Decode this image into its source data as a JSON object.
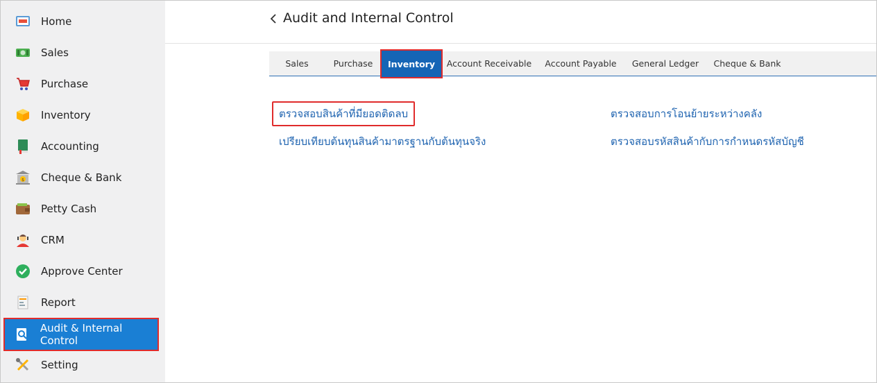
{
  "sidebar": {
    "items": [
      {
        "label": "Home",
        "icon": "home-icon"
      },
      {
        "label": "Sales",
        "icon": "cash-icon"
      },
      {
        "label": "Purchase",
        "icon": "cart-icon"
      },
      {
        "label": "Inventory",
        "icon": "box-icon"
      },
      {
        "label": "Accounting",
        "icon": "ledger-book-icon"
      },
      {
        "label": "Cheque & Bank",
        "icon": "bank-icon"
      },
      {
        "label": "Petty Cash",
        "icon": "wallet-icon"
      },
      {
        "label": "CRM",
        "icon": "customer-icon"
      },
      {
        "label": "Approve Center",
        "icon": "check-circle-icon"
      },
      {
        "label": "Report",
        "icon": "report-icon"
      },
      {
        "label": "Audit & Internal Control",
        "icon": "audit-search-icon",
        "active": true
      },
      {
        "label": "Setting",
        "icon": "tools-icon"
      }
    ]
  },
  "header": {
    "title": "Audit and Internal Control"
  },
  "tabs": [
    {
      "label": "Sales"
    },
    {
      "label": "Purchase"
    },
    {
      "label": "Inventory",
      "active": true
    },
    {
      "label": "Account Receivable"
    },
    {
      "label": "Account Payable"
    },
    {
      "label": "General Ledger"
    },
    {
      "label": "Cheque & Bank"
    }
  ],
  "links": {
    "left": [
      "ตรวจสอบสินค้าที่มียอดติดลบ",
      "เปรียบเทียบต้นทุนสินค้ามาตรฐานกับต้นทุนจริง"
    ],
    "right": [
      "ตรวจสอบการโอนย้ายระหว่างคลัง",
      "ตรวจสอบรหัสสินค้ากับการกำหนดรหัสบัญชี"
    ]
  },
  "colors": {
    "accent": "#1a7fd4",
    "tab_active": "#1565b6",
    "highlight": "#e02b2b",
    "link": "#1e63b0"
  }
}
